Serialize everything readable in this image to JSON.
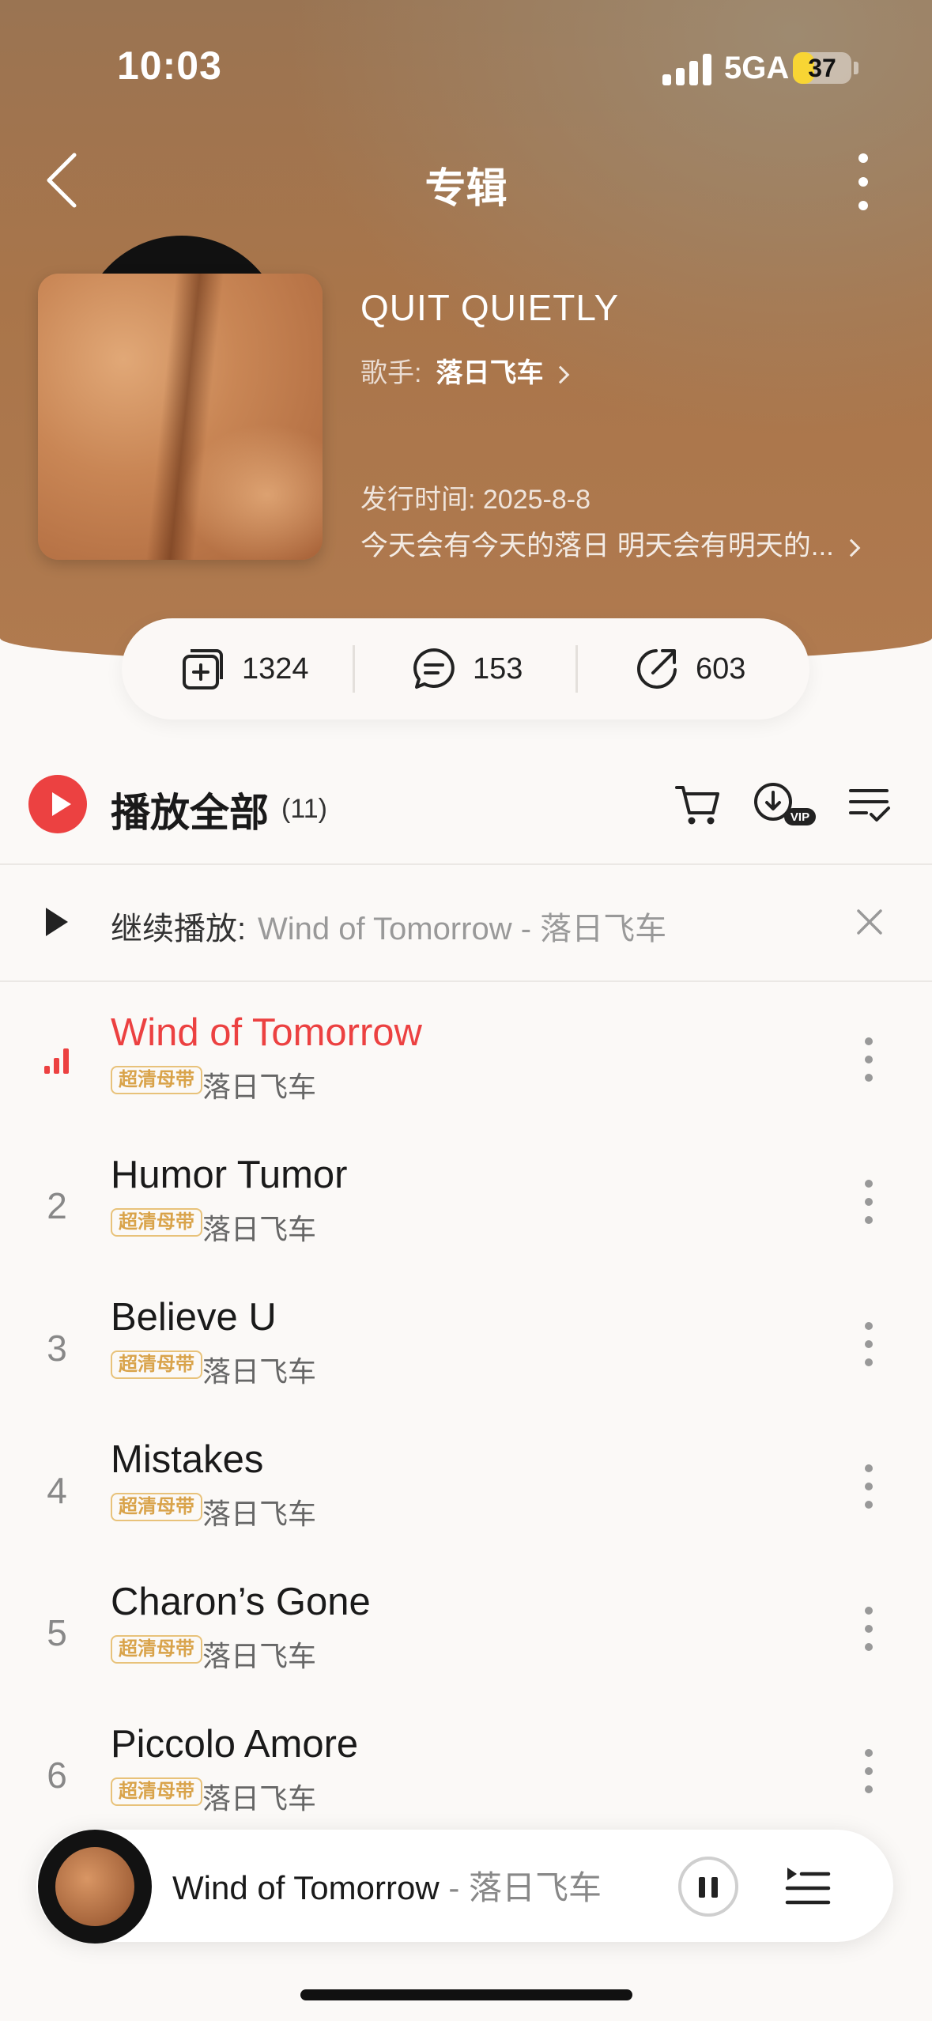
{
  "status_bar": {
    "time": "10:03",
    "network": "5GA",
    "battery": "37",
    "battery_level": 0.37
  },
  "nav": {
    "title": "专辑"
  },
  "album": {
    "title": "QUIT QUIETLY",
    "artist_label": "歌手:",
    "artist": "落日飞车",
    "release": "发行时间: 2025-8-8",
    "description": "今天会有今天的落日 明天会有明天的..."
  },
  "stats": {
    "collect": "1324",
    "comments": "153",
    "shares": "603"
  },
  "play_all": {
    "label": "播放全部",
    "count": "(11)"
  },
  "resume": {
    "label": "继续播放:",
    "track": "Wind of Tomorrow - 落日飞车"
  },
  "songs": [
    {
      "num": "",
      "title": "Wind of Tomorrow",
      "badge": "超清母带",
      "artist": "落日飞车",
      "playing": true
    },
    {
      "num": "2",
      "title": "Humor Tumor",
      "badge": "超清母带",
      "artist": "落日飞车"
    },
    {
      "num": "3",
      "title": "Believe U",
      "badge": "超清母带",
      "artist": "落日飞车"
    },
    {
      "num": "4",
      "title": "Mistakes",
      "badge": "超清母带",
      "artist": "落日飞车"
    },
    {
      "num": "5",
      "title": "Charon’s Gone",
      "badge": "超清母带",
      "artist": "落日飞车"
    },
    {
      "num": "6",
      "title": "Piccolo Amore",
      "badge": "超清母带",
      "artist": "落日飞车"
    }
  ],
  "mini_player": {
    "title": "Wind of Tomorrow",
    "separator": " - ",
    "artist": "落日飞车"
  },
  "colors": {
    "accent": "#ec4141",
    "badge": "#d9a34a",
    "hero": "#a9754a"
  }
}
